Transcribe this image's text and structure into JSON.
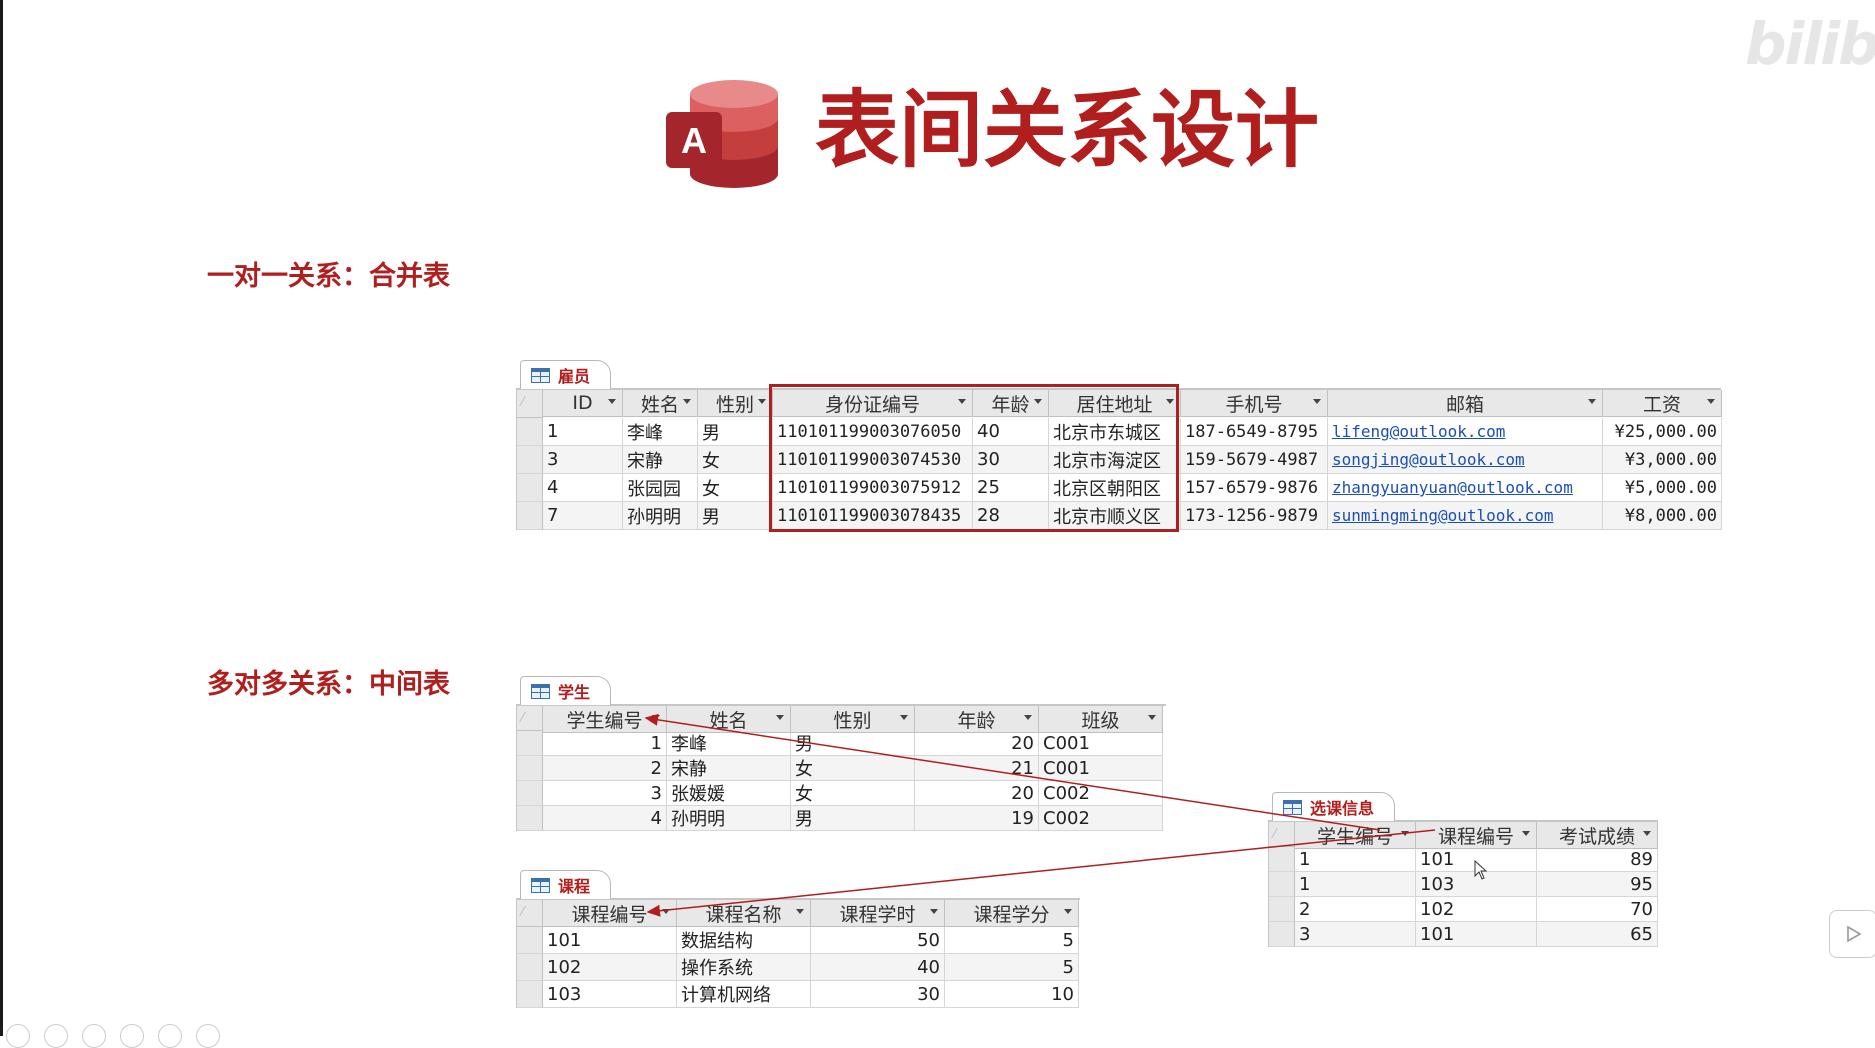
{
  "title": "表间关系设计",
  "logo_letter": "A",
  "watermark": "bilibili",
  "sections": {
    "one_to_one": "一对一关系：合并表",
    "many_to_many": "多对多关系：中间表"
  },
  "colors": {
    "accent": "#b01e1e",
    "link": "#1a4fb5",
    "header_bg": "#e8e8e8"
  },
  "employees": {
    "tab": "雇员",
    "columns": [
      "ID",
      "姓名",
      "性别",
      "身份证编号",
      "年龄",
      "居住地址",
      "手机号",
      "邮箱",
      "工资"
    ],
    "rows": [
      [
        "1",
        "李峰",
        "男",
        "110101199003076050",
        "40",
        "北京市东城区",
        "187-6549-8795",
        "lifeng@outlook.com",
        "¥25,000.00"
      ],
      [
        "3",
        "宋静",
        "女",
        "110101199003074530",
        "30",
        "北京市海淀区",
        "159-5679-4987",
        "songjing@outlook.com",
        "¥3,000.00"
      ],
      [
        "4",
        "张园园",
        "女",
        "110101199003075912",
        "25",
        "北京区朝阳区",
        "157-6579-9876",
        "zhangyuanyuan@outlook.com",
        "¥5,000.00"
      ],
      [
        "7",
        "孙明明",
        "男",
        "110101199003078435",
        "28",
        "北京市顺义区",
        "173-1256-9879",
        "sunmingming@outlook.com",
        "¥8,000.00"
      ]
    ]
  },
  "students": {
    "tab": "学生",
    "columns": [
      "学生编号",
      "姓名",
      "性别",
      "年龄",
      "班级"
    ],
    "rows": [
      [
        "1",
        "李峰",
        "男",
        "20",
        "C001"
      ],
      [
        "2",
        "宋静",
        "女",
        "21",
        "C001"
      ],
      [
        "3",
        "张媛媛",
        "女",
        "20",
        "C002"
      ],
      [
        "4",
        "孙明明",
        "男",
        "19",
        "C002"
      ]
    ]
  },
  "courses": {
    "tab": "课程",
    "columns": [
      "课程编号",
      "课程名称",
      "课程学时",
      "课程学分"
    ],
    "rows": [
      [
        "101",
        "数据结构",
        "50",
        "5"
      ],
      [
        "102",
        "操作系统",
        "40",
        "5"
      ],
      [
        "103",
        "计算机网络",
        "30",
        "10"
      ]
    ]
  },
  "enrollment": {
    "tab": "选课信息",
    "columns": [
      "学生编号",
      "课程编号",
      "考试成绩"
    ],
    "rows": [
      [
        "1",
        "101",
        "89"
      ],
      [
        "1",
        "103",
        "95"
      ],
      [
        "2",
        "102",
        "70"
      ],
      [
        "3",
        "101",
        "65"
      ]
    ]
  }
}
